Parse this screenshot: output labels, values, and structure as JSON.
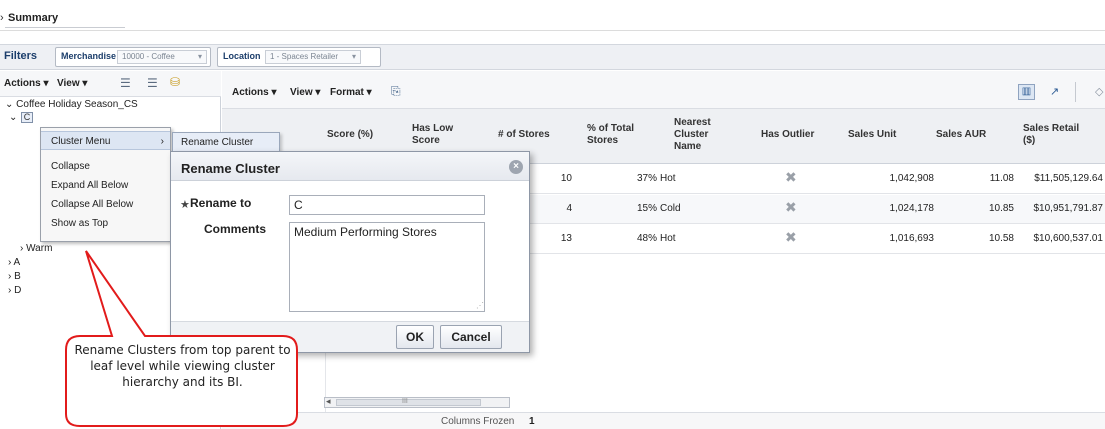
{
  "summary": {
    "label": "Summary",
    "chevron": "›"
  },
  "filters": {
    "label": "Filters",
    "merchandise": {
      "label": "Merchandise",
      "value": "10000 - Coffee"
    },
    "location": {
      "label": "Location",
      "value": "1 - Spaces Retailer"
    }
  },
  "left_toolbar": {
    "actions": "Actions ▾",
    "view": "View ▾"
  },
  "tree": {
    "root": "⌄ Coffee Holiday Season_CS",
    "c_node": "C",
    "items": [
      "› Warm",
      "› A",
      "› B",
      "› D"
    ]
  },
  "context_menu": {
    "items": [
      "Cluster Menu",
      "Collapse",
      "Expand All Below",
      "Collapse All Below",
      "Show as Top"
    ],
    "submenu_arrow": "›",
    "submenu": "Rename Cluster"
  },
  "main_toolbar": {
    "actions": "Actions ▾",
    "view": "View ▾",
    "format": "Format ▾"
  },
  "grid": {
    "headers": [
      "Score (%)",
      "Has Low Score",
      "# of Stores",
      "% of Total Stores",
      "Nearest Cluster Name",
      "Has Outlier",
      "Sales Unit",
      "Sales AUR",
      "Sales Retail ($)"
    ],
    "rows": [
      {
        "stores": "10",
        "pct": "37%",
        "nearest": "Hot",
        "sales_unit": "1,042,908",
        "aur": "11.08",
        "retail": "$11,505,129.64"
      },
      {
        "stores": "4",
        "pct": "15%",
        "nearest": "Cold",
        "sales_unit": "1,024,178",
        "aur": "10.85",
        "retail": "$10,951,791.87"
      },
      {
        "stores": "13",
        "pct": "48%",
        "nearest": "Hot",
        "sales_unit": "1,016,693",
        "aur": "10.58",
        "retail": "$10,600,537.01"
      }
    ],
    "outlier_icon": "✖",
    "scroll_label": "III",
    "columns_frozen_label": "Columns Frozen",
    "columns_frozen_value": "1"
  },
  "dialog": {
    "title": "Rename Cluster",
    "close": "×",
    "required_star": "★",
    "rename_label": "Rename to",
    "rename_value": "C",
    "comments_label": "Comments",
    "comments_value": "Medium Performing Stores",
    "ok": "OK",
    "cancel": "Cancel"
  },
  "callout": {
    "text": "Rename Clusters from top parent to leaf level while viewing cluster hierarchy and its BI."
  },
  "colors": {
    "callout_border": "#e21b1b",
    "menu_highlight": "#dde6f3",
    "header_bg": "#eef0f3"
  },
  "icons": [
    "expand-all-icon",
    "collapse-all-icon",
    "hierarchy-icon",
    "export-icon",
    "outlier-x-icon",
    "close-icon",
    "detach-icon",
    "column-view-icon"
  ]
}
